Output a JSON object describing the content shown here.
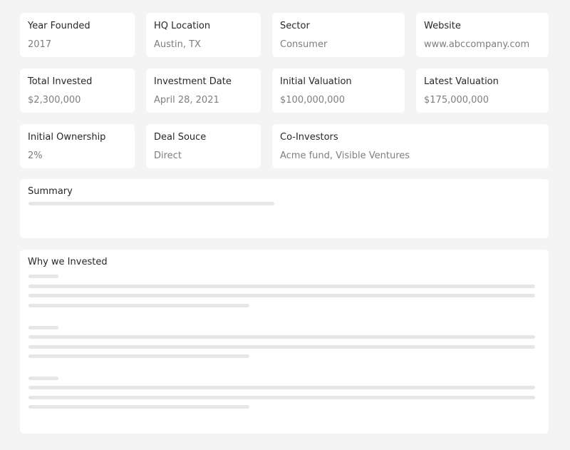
{
  "fields": {
    "year_founded": {
      "label": "Year Founded",
      "value": "2017"
    },
    "hq_location": {
      "label": "HQ Location",
      "value": "Austin, TX"
    },
    "sector": {
      "label": "Sector",
      "value": "Consumer"
    },
    "website": {
      "label": "Website",
      "value": "www.abccompany.com"
    },
    "total_invested": {
      "label": "Total Invested",
      "value": "$2,300,000"
    },
    "investment_date": {
      "label": "Investment Date",
      "value": "April 28, 2021"
    },
    "initial_valuation": {
      "label": "Initial Valuation",
      "value": "$100,000,000"
    },
    "latest_valuation": {
      "label": "Latest Valuation",
      "value": "$175,000,000"
    },
    "initial_ownership": {
      "label": "Initial Ownership",
      "value": "2%"
    },
    "deal_source": {
      "label": "Deal Souce",
      "value": "Direct"
    },
    "co_investors": {
      "label": "Co-Investors",
      "value": "Acme fund, Visible Ventures"
    }
  },
  "summary": {
    "title": "Summary"
  },
  "why_invested": {
    "title": "Why we Invested"
  }
}
